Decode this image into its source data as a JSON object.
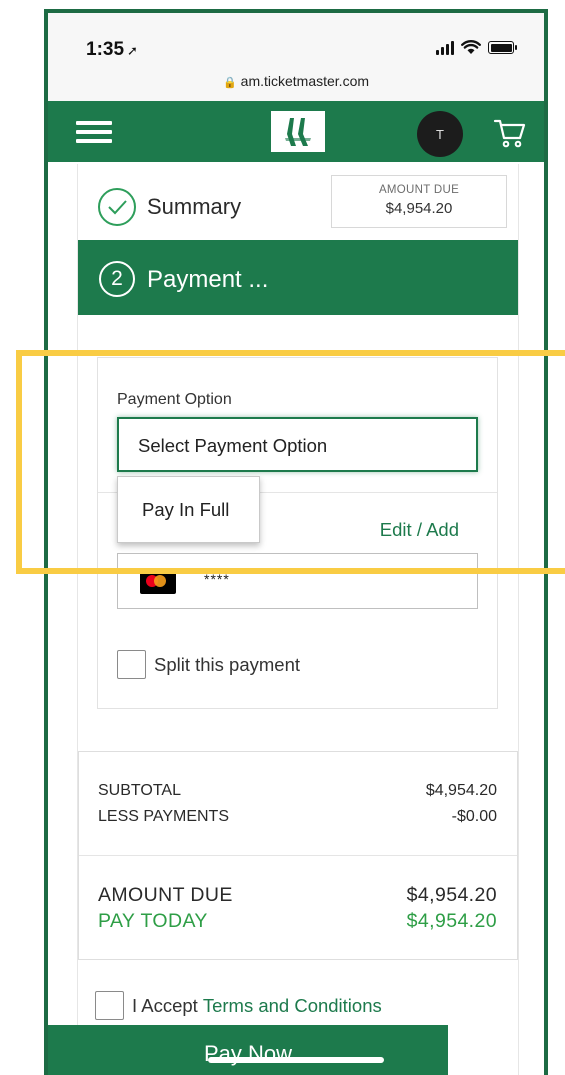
{
  "status_bar": {
    "time": "1:35",
    "location_glyph": "➚",
    "url": "am.ticketmaster.com"
  },
  "header": {
    "avatar_initial": "T",
    "icons": [
      "hamburger-menu-icon",
      "team-logo",
      "cart-icon"
    ]
  },
  "summary": {
    "label": "Summary",
    "amount_due_label": "AMOUNT DUE",
    "amount_due_value": "$4,954.20"
  },
  "payment": {
    "step_number": "2",
    "title": "Payment ...",
    "option_label": "Payment Option",
    "option_selected": "Select Payment Option",
    "dropdown_options": [
      "Pay In Full"
    ],
    "edit_add_label": "Edit / Add",
    "card_mask": "****",
    "split_label": "Split this payment"
  },
  "totals": {
    "subtotal_label": "SUBTOTAL",
    "subtotal_value": "$4,954.20",
    "less_payments_label": "LESS PAYMENTS",
    "less_payments_value": "-$0.00",
    "amount_due_label": "AMOUNT DUE",
    "amount_due_value": "$4,954.20",
    "pay_today_label": "PAY TODAY",
    "pay_today_value": "$4,954.20"
  },
  "accept": {
    "prefix": "I Accept",
    "link": "Terms and Conditions"
  },
  "pay_button_label": "Pay Now",
  "colors": {
    "brand_green": "#1d7a4c",
    "accent_green": "#2e9e46",
    "highlight_yellow": "#f9cc44"
  }
}
